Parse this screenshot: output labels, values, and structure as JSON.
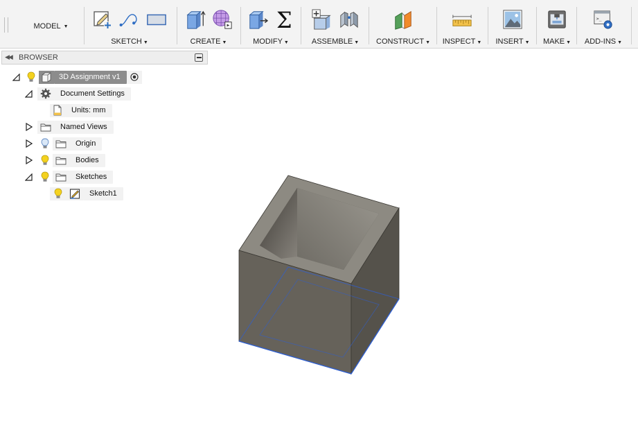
{
  "workspace": {
    "label": "MODEL"
  },
  "toolbar": {
    "groups": [
      {
        "label": "SKETCH"
      },
      {
        "label": "CREATE"
      },
      {
        "label": "MODIFY"
      },
      {
        "label": "ASSEMBLE"
      },
      {
        "label": "CONSTRUCT"
      },
      {
        "label": "INSPECT"
      },
      {
        "label": "INSERT"
      },
      {
        "label": "MAKE"
      },
      {
        "label": "ADD-INS"
      }
    ]
  },
  "browser": {
    "title": "BROWSER",
    "root": {
      "label": "3D Assignment v1"
    },
    "items": {
      "document_settings": "Document Settings",
      "units": "Units: mm",
      "named_views": "Named Views",
      "origin": "Origin",
      "bodies": "Bodies",
      "sketches": "Sketches",
      "sketch1": "Sketch1"
    }
  },
  "icons": {
    "collapse": "double-left-arrow-icon",
    "minimize": "minus-box-icon",
    "visibility": "lightbulb-icon",
    "folder": "folder-icon",
    "settings": "gear-icon",
    "units": "document-icon",
    "sketch": "sketch-icon",
    "component": "component-box-icon",
    "active": "radio-target-icon"
  },
  "colors": {
    "bulb_on": "#f4d21f",
    "bulb_off": "#a9c5ea",
    "selected_bg": "#8c8c8c",
    "body_fill": "#67635b",
    "sketch_line": "#2f5fd0"
  }
}
